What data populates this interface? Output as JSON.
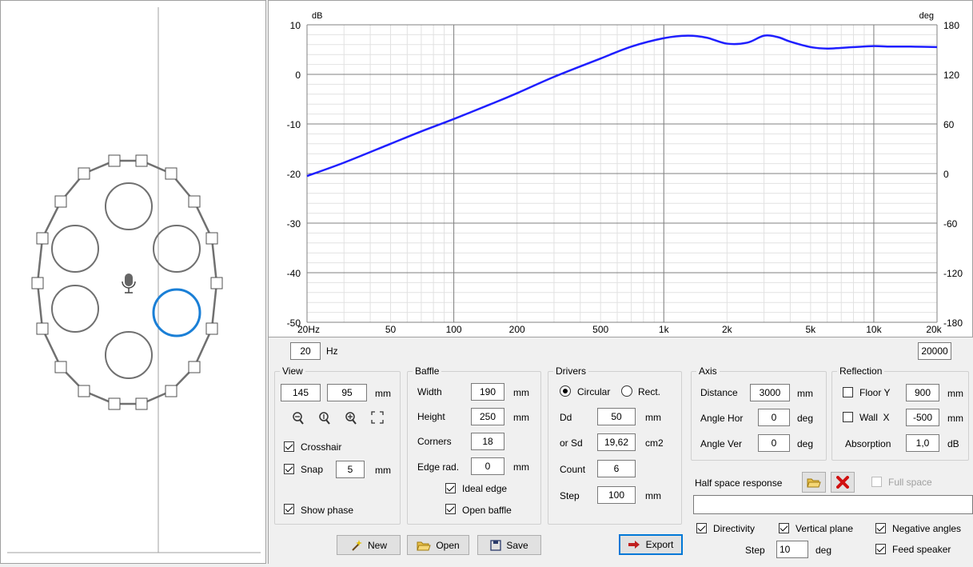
{
  "chart_data": {
    "type": "line",
    "y_left_unit": "dB",
    "y_right_unit": "deg",
    "y_left_ticks": [
      "10",
      "0",
      "-10",
      "-20",
      "-30",
      "-40",
      "-50"
    ],
    "y_right_ticks": [
      "180",
      "120",
      "60",
      "0",
      "-60",
      "-120",
      "-180"
    ],
    "x_ticks": [
      "20Hz",
      "50",
      "100",
      "200",
      "500",
      "1k",
      "2k",
      "5k",
      "10k",
      "20k"
    ],
    "xlim": [
      20,
      20000
    ],
    "ylim": [
      -50,
      10
    ],
    "x_scale": "log",
    "grid": true,
    "series": [
      {
        "color": "#1f1fff",
        "x": [
          20,
          30,
          50,
          70,
          100,
          150,
          200,
          300,
          500,
          700,
          1000,
          1300,
          1600,
          2000,
          2500,
          3000,
          3500,
          4000,
          5000,
          6000,
          8000,
          10000,
          12000,
          15000,
          20000
        ],
        "y": [
          -20.5,
          -17.8,
          -14,
          -11.5,
          -9,
          -6,
          -3.8,
          -0.5,
          3.2,
          5.6,
          7.3,
          7.8,
          7.4,
          6.2,
          6.4,
          7.8,
          7.5,
          6.6,
          5.5,
          5.2,
          5.5,
          5.7,
          5.6,
          5.6,
          5.5
        ]
      }
    ]
  },
  "freq": {
    "min": "20",
    "min_unit": "Hz",
    "max": "20000"
  },
  "view": {
    "title": "View",
    "x": "145",
    "y": "95",
    "unit": "mm",
    "crosshair_label": "Crosshair",
    "snap_label": "Snap",
    "snap_value": "5",
    "snap_unit": "mm",
    "show_phase_label": "Show phase"
  },
  "baffle": {
    "title": "Baffle",
    "width_label": "Width",
    "width": "190",
    "width_unit": "mm",
    "height_label": "Height",
    "height": "250",
    "height_unit": "mm",
    "corners_label": "Corners",
    "corners": "18",
    "edge_label": "Edge rad.",
    "edge": "0",
    "edge_unit": "mm",
    "ideal_edge_label": "Ideal edge",
    "open_baffle_label": "Open baffle"
  },
  "drivers": {
    "title": "Drivers",
    "circular_label": "Circular",
    "rect_label": "Rect.",
    "dd_label": "Dd",
    "dd": "50",
    "dd_unit": "mm",
    "sd_label": "or Sd",
    "sd": "19,62",
    "sd_unit": "cm2",
    "count_label": "Count",
    "count": "6",
    "step_label": "Step",
    "step": "100",
    "step_unit": "mm"
  },
  "axis": {
    "title": "Axis",
    "distance_label": "Distance",
    "distance": "3000",
    "distance_unit": "mm",
    "angle_hor_label": "Angle Hor",
    "angle_hor": "0",
    "angle_hor_unit": "deg",
    "angle_ver_label": "Angle Ver",
    "angle_ver": "0",
    "angle_ver_unit": "deg"
  },
  "reflection": {
    "title": "Reflection",
    "floor_label": "Floor Y",
    "floor": "900",
    "floor_unit": "mm",
    "wall_label": "Wall  X",
    "wall": "-500",
    "wall_unit": "mm",
    "absorption_label": "Absorption",
    "absorption": "1,0",
    "absorption_unit": "dB"
  },
  "half_space": {
    "label": "Half space response",
    "full_space_label": "Full space",
    "path": ""
  },
  "options": {
    "directivity_label": "Directivity",
    "vertical_plane_label": "Vertical plane",
    "negative_angles_label": "Negative angles",
    "step_label": "Step",
    "step": "10",
    "step_unit": "deg",
    "feed_speaker_label": "Feed speaker"
  },
  "buttons": {
    "new": "New",
    "open": "Open",
    "save": "Save",
    "export": "Export"
  }
}
